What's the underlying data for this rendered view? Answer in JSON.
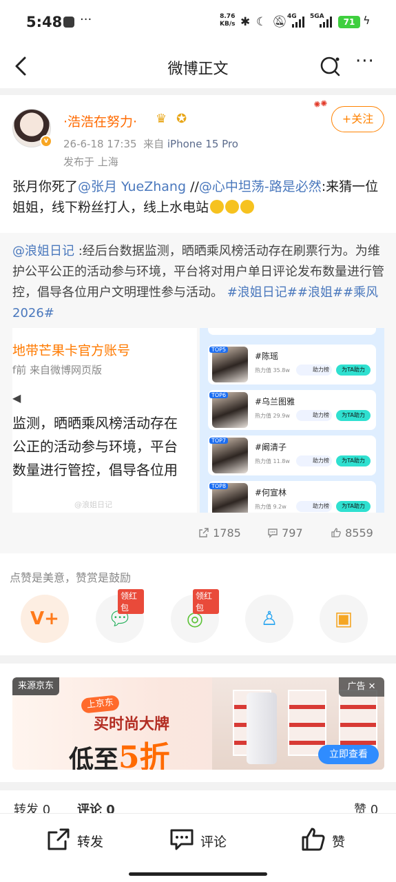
{
  "status_bar": {
    "time": "5:48",
    "more": "···",
    "net_speed_value": "8.76",
    "net_speed_unit": "KB/s",
    "net1": "4G",
    "net2": "5GA",
    "battery": "71"
  },
  "nav": {
    "title": "微博正文",
    "more": "···"
  },
  "post": {
    "username": "·浩浩在努力·",
    "time": "26-6-18 17:35",
    "source_prefix": "来自",
    "device": "iPhone 15 Pro",
    "location": "发布于 上海",
    "follow_label": "+关注",
    "text_a": "张月你死了",
    "mention1": "@张月 YueZhang",
    "text_b": " //",
    "mention2": "@心中坦荡-路是必然",
    "text_c": ":来猜一位姐姐，线下粉丝打人，线上水电站"
  },
  "repost": {
    "mention": "@浪姐日记",
    "text": " :经后台数据监测，晒晒乘风榜活动存在刷票行为。为维护公平公正的活动参与环境，平台将对用户单日评论发布数量进行管控，倡导各位用户文明理性参与活动。",
    "tags": " #浪姐日记##浪姐##乘风2026#",
    "pic1": {
      "title": "地带芒果卡官方账号",
      "sub": "f前  来自微博网页版",
      "line1": "监测，晒晒乘风榜活动存在",
      "line2": "公正的活动参与环境，平台",
      "line3": "数量进行管控，倡导各位用",
      "watermark": "@浪姐日记"
    },
    "ranks": [
      {
        "top": "TOP5",
        "name": "#陈瑶",
        "heat": "热力值 35.8w",
        "help": "助力榜",
        "btn": "为TA助力"
      },
      {
        "top": "TOP6",
        "name": "#乌兰图雅",
        "heat": "热力值 29.9w",
        "help": "助力榜",
        "btn": "为TA助力"
      },
      {
        "top": "TOP7",
        "name": "#阚清子",
        "heat": "热力值 11.8w",
        "help": "助力榜",
        "btn": "为TA助力"
      },
      {
        "top": "TOP8",
        "name": "#何宣林",
        "heat": "热力值 9.2w",
        "help": "助力榜",
        "btn": "为TA助力"
      }
    ]
  },
  "stats": {
    "reposts": "1785",
    "comments": "797",
    "likes": "8559"
  },
  "reward": {
    "label": "点赞是美意，赞赏是鼓励",
    "hongbao1": "领红包",
    "hongbao2": "领红包"
  },
  "ad": {
    "source": "来源京东",
    "tag": "广告 ✕",
    "jd": "上京东",
    "headline1": "买时尚大牌",
    "headline2_a": "低至",
    "headline2_b": "5折",
    "cta": "立即查看"
  },
  "tabs": {
    "repost": "转发 0",
    "comment": "评论 0",
    "like": "赞 0"
  },
  "bottom": {
    "repost": "转发",
    "comment": "评论",
    "like": "赞"
  }
}
